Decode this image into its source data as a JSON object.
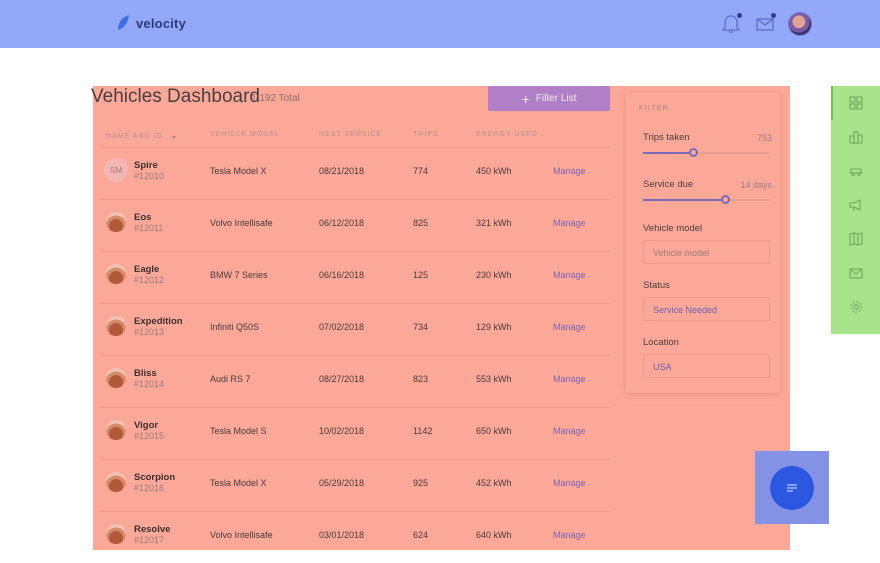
{
  "brand": {
    "name": "velocity"
  },
  "header": {
    "title": "Vehicles Dashboard",
    "total": "1 192 Total",
    "filter_button": "Filter List"
  },
  "columns": {
    "name": "NAME AND ID",
    "model": "VEHICLE MODEL",
    "service": "NEXT SERVICE",
    "trips": "TRIPS",
    "energy": "ENERGY USED"
  },
  "rows": [
    {
      "initials": "SM",
      "name": "Spire",
      "id": "#12010",
      "model": "Tesla Model X",
      "service": "08/21/2018",
      "trips": "774",
      "energy": "450 kWh",
      "action": "Manage"
    },
    {
      "initials": "",
      "name": "Eos",
      "id": "#12011",
      "model": "Volvo Intellisafe",
      "service": "06/12/2018",
      "trips": "825",
      "energy": "321 kWh",
      "action": "Manage"
    },
    {
      "initials": "",
      "name": "Eagle",
      "id": "#12012",
      "model": "BMW 7 Series",
      "service": "06/16/2018",
      "trips": "125",
      "energy": "230 kWh",
      "action": "Manage"
    },
    {
      "initials": "",
      "name": "Expedition",
      "id": "#12013",
      "model": "Infiniti Q50S",
      "service": "07/02/2018",
      "trips": "734",
      "energy": "129 kWh",
      "action": "Manage"
    },
    {
      "initials": "",
      "name": "Bliss",
      "id": "#12014",
      "model": "Audi RS 7",
      "service": "08/27/2018",
      "trips": "823",
      "energy": "553 kWh",
      "action": "Manage"
    },
    {
      "initials": "",
      "name": "Vigor",
      "id": "#12015",
      "model": "Tesla Model S",
      "service": "10/02/2018",
      "trips": "1142",
      "energy": "650 kWh",
      "action": "Manage"
    },
    {
      "initials": "",
      "name": "Scorpion",
      "id": "#12016",
      "model": "Tesla Model X",
      "service": "05/29/2018",
      "trips": "925",
      "energy": "452 kWh",
      "action": "Manage"
    },
    {
      "initials": "",
      "name": "Resolve",
      "id": "#12017",
      "model": "Volvo Intellisafe",
      "service": "03/01/2018",
      "trips": "624",
      "energy": "640 kWh",
      "action": "Manage"
    }
  ],
  "filter": {
    "heading": "FILTER",
    "trips_label": "Trips taken",
    "trips_value": "753",
    "trips_level": 0.4,
    "service_label": "Service due",
    "service_value": "14 days",
    "service_level": 0.65,
    "model_label": "Vehicle model",
    "model_placeholder": "Vehicle model",
    "status_label": "Status",
    "status_value": "Service Needed",
    "location_label": "Location",
    "location_value": "USA"
  },
  "sidebar": {
    "items": [
      "dashboard-icon",
      "buildings-icon",
      "car-icon",
      "megaphone-icon",
      "map-icon",
      "mail-icon",
      "settings-icon"
    ]
  }
}
